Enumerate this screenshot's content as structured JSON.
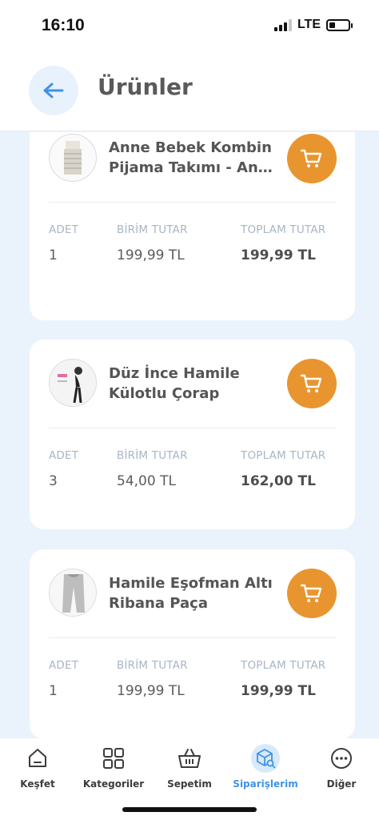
{
  "status": {
    "time": "16:10",
    "network": "LTE"
  },
  "header": {
    "title": "Ürünler"
  },
  "labels": {
    "qty": "ADET",
    "unit": "BİRİM TUTAR",
    "total": "TOPLAM TUTAR"
  },
  "products": [
    {
      "name_line1": "Anne Bebek Kombin",
      "name_line2": "Pijama Takımı - Anne…",
      "qty": "1",
      "unit_price": "199,99 TL",
      "total_price": "199,99 TL"
    },
    {
      "name_line1": "Düz İnce Hamile",
      "name_line2": "Külotlu Çorap",
      "qty": "3",
      "unit_price": "54,00 TL",
      "total_price": "162,00 TL"
    },
    {
      "name_line1": "Hamile Eşofman Altı",
      "name_line2": "Ribana Paça",
      "qty": "1",
      "unit_price": "199,99 TL",
      "total_price": "199,99 TL"
    }
  ],
  "tabs": [
    {
      "label": "Keşfet",
      "icon": "home-icon"
    },
    {
      "label": "Kategoriler",
      "icon": "grid-icon"
    },
    {
      "label": "Sepetim",
      "icon": "basket-icon"
    },
    {
      "label": "Siparişlerim",
      "icon": "box-search-icon",
      "active": true
    },
    {
      "label": "Diğer",
      "icon": "more-icon"
    }
  ],
  "colors": {
    "accent": "#3f93e6",
    "cart": "#e8952f",
    "background": "#eaf3fc"
  }
}
